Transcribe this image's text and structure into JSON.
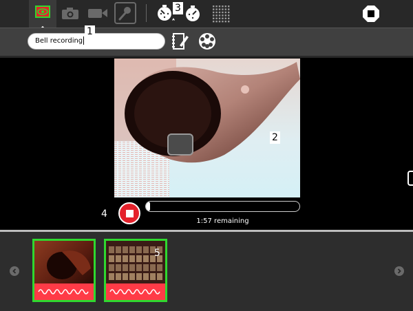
{
  "toolbar": {
    "tools": [
      {
        "name": "view",
        "icon": "eye-icon",
        "active": true
      },
      {
        "name": "photo",
        "icon": "camera-icon"
      },
      {
        "name": "video",
        "icon": "video-camera-icon"
      },
      {
        "name": "audio",
        "icon": "microphone-icon"
      }
    ],
    "timer_icons": [
      "timer-icon",
      "duration-icon"
    ],
    "grid_icon": "grid-icon",
    "stop_icon": "stop-icon"
  },
  "recording": {
    "name_value": "Bell recording",
    "remaining": "1:57 remaining",
    "progress": 0.01
  },
  "tray": {
    "items": [
      {
        "name": "bell-thumbnail",
        "type": "audio"
      },
      {
        "name": "keyboard-thumbnail",
        "type": "audio"
      }
    ]
  },
  "callouts": {
    "c1": "1",
    "c2": "2",
    "c3": "3",
    "c4": "4",
    "c5": "5"
  },
  "colors": {
    "accent_green": "#2fd82f",
    "record_red": "#e4222c",
    "audio_strip": "#ff3b47"
  }
}
